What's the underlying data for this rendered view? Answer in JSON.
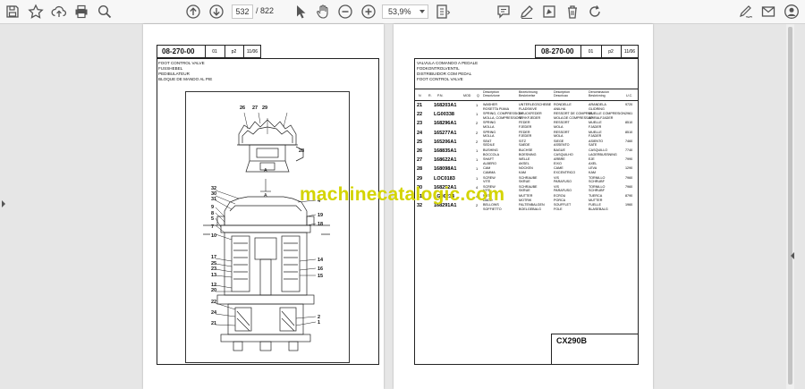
{
  "toolbar": {
    "page_current": "532",
    "page_total": "/ 822",
    "zoom": "53,9%"
  },
  "left_page": {
    "code": "08-270-00",
    "sheet": "01",
    "part": "p2",
    "date": "11/06",
    "titles": [
      "FOOT CONTROL VALVE",
      "FUSSHEBEL",
      "PEDIBULATEUR",
      "BLOQUE DE MANDO AL PIE"
    ],
    "callouts_top": [
      "26",
      "27",
      "29"
    ],
    "callout_a": "A",
    "callout_section": "A",
    "callouts_left": [
      "32",
      "30",
      "31",
      "9",
      "8",
      "5",
      "7",
      "10",
      "17",
      "25",
      "23",
      "13",
      "12",
      "20",
      "22",
      "24",
      "21"
    ],
    "callouts_right": [
      "4",
      "19",
      "18",
      "14",
      "16",
      "15",
      "2",
      "1"
    ],
    "callout_28": "28"
  },
  "right_page": {
    "code": "08-270-00",
    "sheet": "01",
    "part": "p2",
    "date": "11/06",
    "titles": [
      "VALVULA COMANDO A PEDALE",
      "FODKONTROLVENTIL",
      "DISTRIBUIDOR COM PEDAL",
      "FOOT CONTROL VALVE"
    ],
    "columns": [
      "N",
      "R.",
      "P.N.",
      "MOD",
      "Q",
      "Description Descrizione",
      "Bezeichnung Beskrivelse",
      "Description Descricao",
      "Denominacion Beskrivning",
      "U.C."
    ],
    "rows": [
      {
        "ref": "21",
        "pn": "168203A1",
        "qty": "1",
        "d1": [
          "WASHER",
          "ROSETTA PIANA"
        ],
        "d2": [
          "UNTERLEGSCHEIBE",
          "FLADSKIVE"
        ],
        "d3": [
          "RONDELLE",
          "ANILHA"
        ],
        "d4": [
          "ARANDELA",
          "GLIDRING"
        ],
        "uc": "9720"
      },
      {
        "ref": "22",
        "pn": "LG00338",
        "qty": "1",
        "d1": [
          "SPRING, COMPRESSION",
          "MOLLA, COMPRESSIONE"
        ],
        "d2": [
          "DRUCKFEDER",
          "TRYKFJEDER"
        ],
        "d3": [
          "RESSORT DE COMPRES.",
          "MOLA DE COMPRESSAO"
        ],
        "d4": [
          "MUELLE COMPRESION",
          "SPIRALFJADER"
        ],
        "uc": "2961"
      },
      {
        "ref": "23",
        "pn": "168296A1",
        "qty": "2",
        "d1": [
          "SPRING",
          "MOLLA"
        ],
        "d2": [
          "FEDER",
          "FJEDER"
        ],
        "d3": [
          "RESSORT",
          "MOLA"
        ],
        "d4": [
          "MUELLE",
          "FJADER"
        ],
        "uc": "8510"
      },
      {
        "ref": "24",
        "pn": "165277A1",
        "qty": "2",
        "d1": [
          "SPRING",
          "MOLLA"
        ],
        "d2": [
          "FEDER",
          "FJEDER"
        ],
        "d3": [
          "RESSORT",
          "MOLA"
        ],
        "d4": [
          "MUELLE",
          "FJADER"
        ],
        "uc": "8510"
      },
      {
        "ref": "25",
        "pn": "165206A1",
        "qty": "2",
        "d1": [
          "SEAT",
          "SEDILE"
        ],
        "d2": [
          "SITZ",
          "SAEDE"
        ],
        "d3": [
          "SIEGE",
          "ASSENTO"
        ],
        "d4": [
          "ASIENTO",
          "SATE"
        ],
        "uc": "7460"
      },
      {
        "ref": "26",
        "pn": "168835A1",
        "qty": "1",
        "d1": [
          "BUSHING",
          "BOCCOLA"
        ],
        "d2": [
          "BUCHSE",
          "BOESNING"
        ],
        "d3": [
          "BAGUE",
          "CASQUILHO"
        ],
        "d4": [
          "CASQUILLO",
          "LAGERBUSSNING"
        ],
        "uc": "7740"
      },
      {
        "ref": "27",
        "pn": "168622A1",
        "qty": "1",
        "d1": [
          "SHAFT",
          "ALBERO"
        ],
        "d2": [
          "WELLE",
          "AKSEL"
        ],
        "d3": [
          "ARBRE",
          "EIXO"
        ],
        "d4": [
          "EJE",
          "AXEL"
        ],
        "uc": "7990"
      },
      {
        "ref": "28",
        "pn": "168098A1",
        "qty": "1",
        "d1": [
          "CAM",
          "CAMMA"
        ],
        "d2": [
          "NOCKEN",
          "KAM"
        ],
        "d3": [
          "CAME",
          "EXCENTRICO"
        ],
        "d4": [
          "LEVA",
          "KAM"
        ],
        "uc": "1290"
      },
      {
        "ref": "29",
        "pn": "LOC0183",
        "qty": "1",
        "d1": [
          "SCREW",
          "VITE"
        ],
        "d2": [
          "SCHRAUBE",
          "SKRUE"
        ],
        "d3": [
          "VIS",
          "PARAFUSO"
        ],
        "d4": [
          "TORNILLO",
          "SCHRUBF"
        ],
        "uc": "7960"
      },
      {
        "ref": "30",
        "pn": "168252A1",
        "qty": "4",
        "d1": [
          "SCREW",
          "VITE"
        ],
        "d2": [
          "SCHRAUBE",
          "SKRUE"
        ],
        "d3": [
          "VIS",
          "PARAFUSO"
        ],
        "d4": [
          "TORNILLO",
          "SCHRUBF"
        ],
        "uc": "7960"
      },
      {
        "ref": "31",
        "pn": "LG00234",
        "qty": "4",
        "d1": [
          "NUT",
          "DADO"
        ],
        "d2": [
          "MUTTER",
          "MOTRIK"
        ],
        "d3": [
          "ECROU",
          "PORCA"
        ],
        "d4": [
          "TUERCA",
          "MUTTER"
        ],
        "uc": "8790"
      },
      {
        "ref": "32",
        "pn": "168291A1",
        "qty": "2",
        "d1": [
          "BELLOWS",
          "SOFFIETTO"
        ],
        "d2": [
          "FALTENBALGEN",
          "BOELGEBALG"
        ],
        "d3": [
          "SOUFFLET",
          "FOLE"
        ],
        "d4": [
          "FUELLE",
          "BLASEBALG"
        ],
        "uc": "1960"
      }
    ],
    "model": "CX290B"
  },
  "watermark": "machinecatalogic.com",
  "colors": {
    "watermark": "#d4d400",
    "toolbar_bg": "#f7f7f7",
    "viewer_bg": "#e6e6e6",
    "icon": "#555555"
  },
  "icons": [
    "save-icon",
    "bookmark-icon",
    "upload-icon",
    "print-icon",
    "zoom-search-icon",
    "page-up-icon",
    "page-down-icon",
    "select-cursor-icon",
    "hand-icon",
    "zoom-out-icon",
    "zoom-in-icon",
    "fit-page-icon",
    "comment-icon",
    "pen-icon",
    "highlight-icon",
    "delete-icon",
    "rotate-icon",
    "sign-icon",
    "mail-icon",
    "account-icon"
  ]
}
